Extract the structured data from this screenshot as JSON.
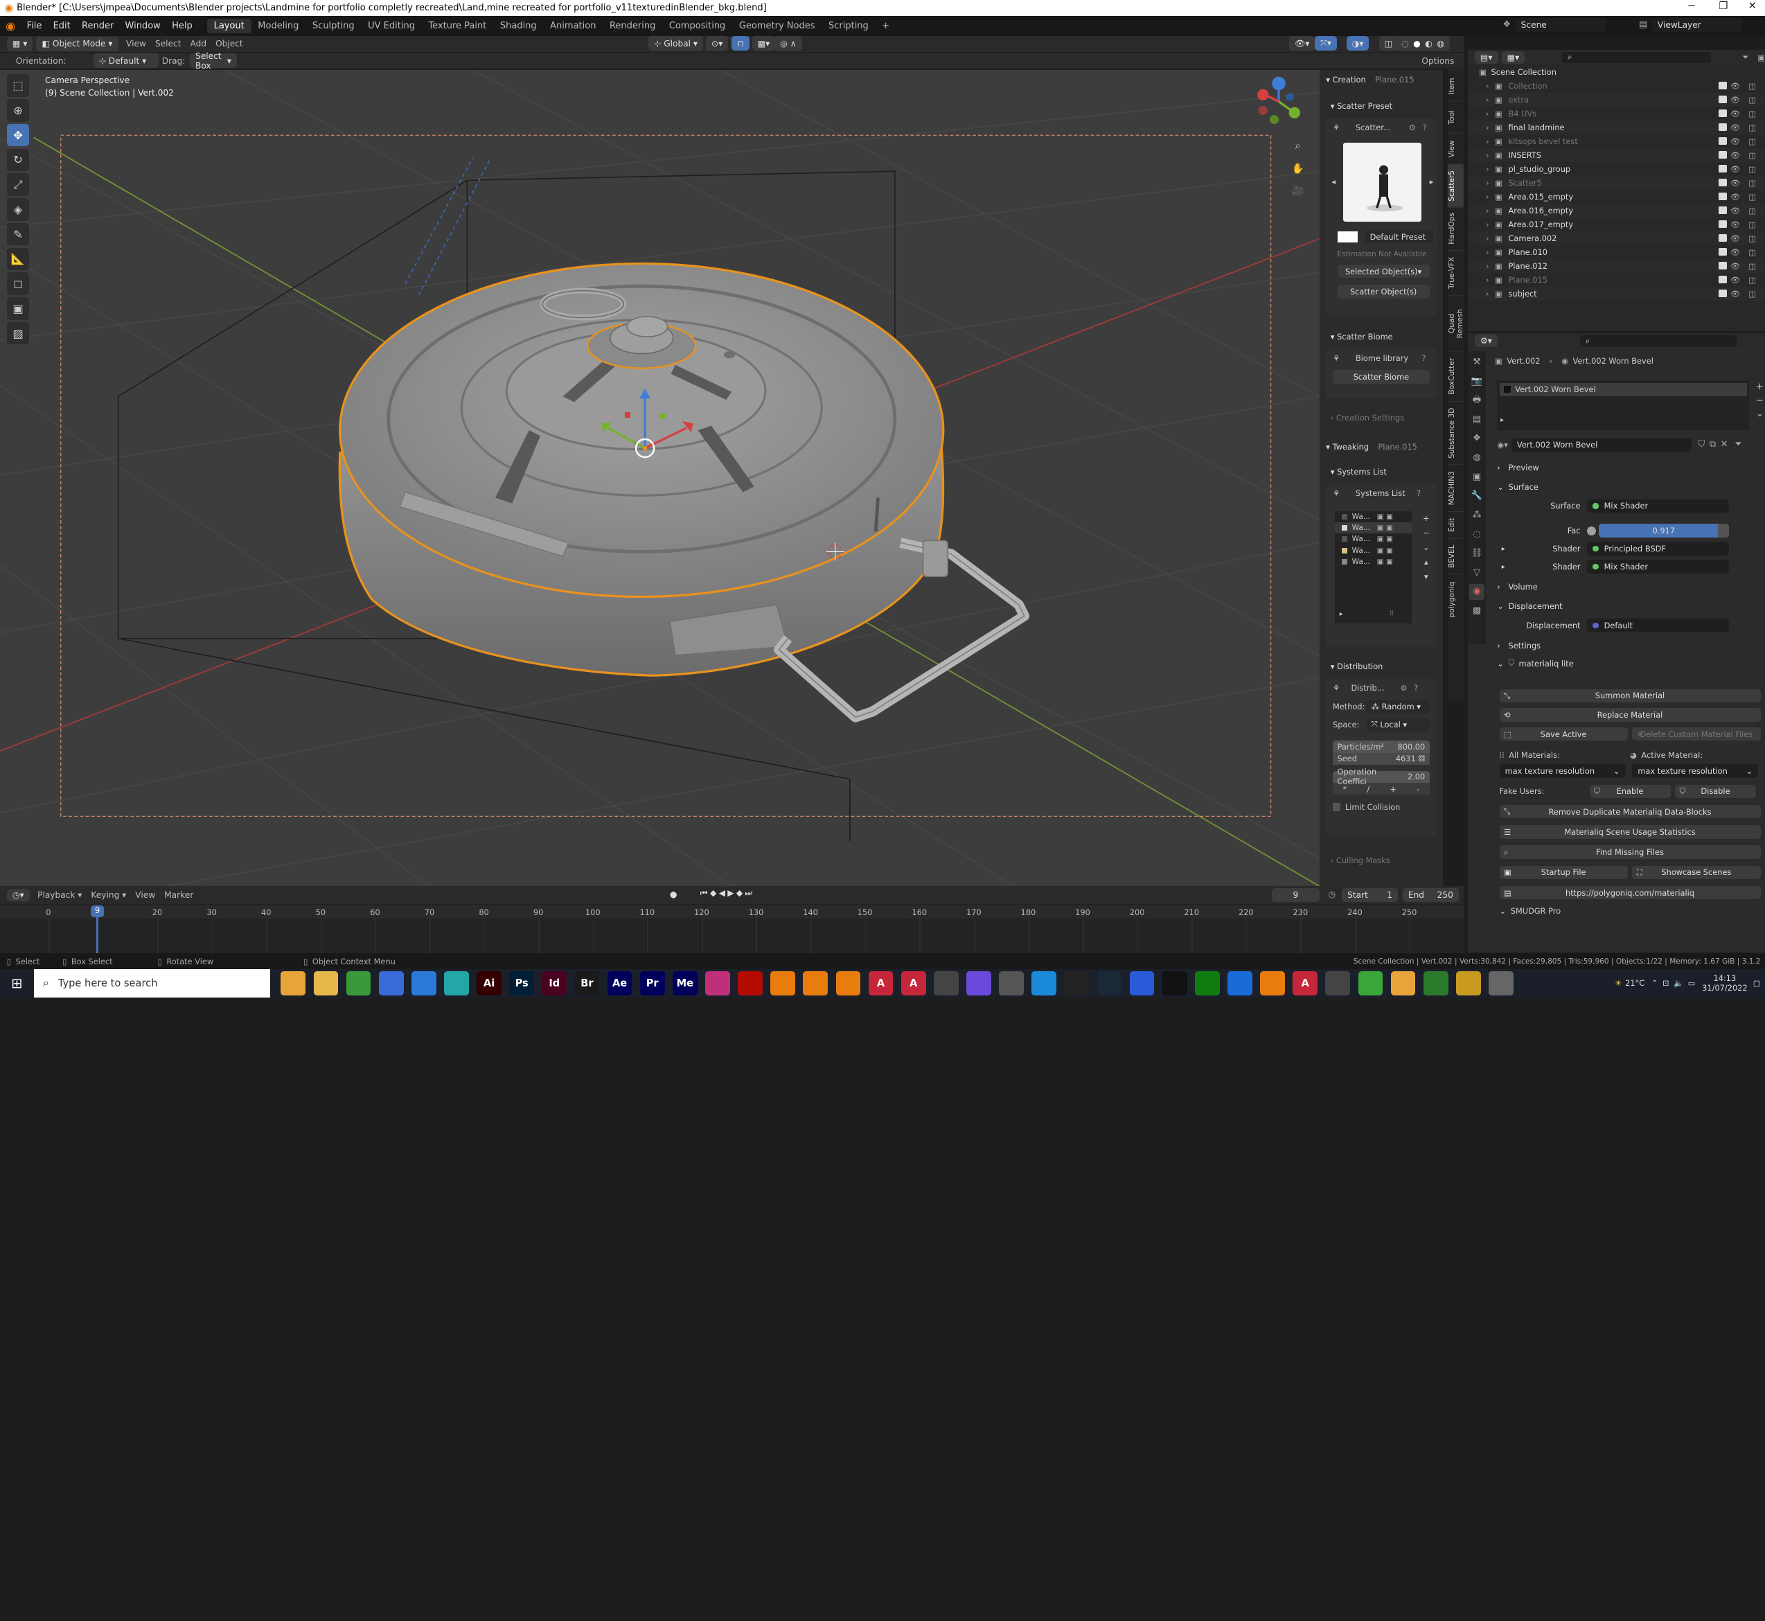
{
  "window": {
    "title": "Blender* [C:\\Users\\jmpea\\Documents\\Blender projects\\Landmine for portfolio completly recreated\\Land,mine recreated for portfolio_v11texturedinBlender_bkg.blend]"
  },
  "menu": {
    "items": [
      "File",
      "Edit",
      "Render",
      "Window",
      "Help"
    ],
    "workspaces": [
      "Layout",
      "Modeling",
      "Sculpting",
      "UV Editing",
      "Texture Paint",
      "Shading",
      "Animation",
      "Rendering",
      "Compositing",
      "Geometry Nodes",
      "Scripting"
    ],
    "active_workspace": "Layout",
    "scene_label": "Scene",
    "view_layer_label": "ViewLayer"
  },
  "viewport_header": {
    "mode": "Object Mode",
    "menus": [
      "View",
      "Select",
      "Add",
      "Object"
    ],
    "transform": "Global",
    "orientation_label": "Orientation:",
    "orientation_value": "Default",
    "drag_label": "Drag:",
    "drag_value": "Select Box",
    "options": "Options"
  },
  "viewport": {
    "camera_label": "Camera Perspective",
    "collection_label": "(9) Scene Collection | Vert.002"
  },
  "npanel": {
    "creation": "Creation",
    "creation_obj": "Plane.015",
    "scatter_preset": "Scatter Preset",
    "scatter_name": "Scatter...",
    "default_preset": "Default Preset",
    "estimation": "Estimation Not Available",
    "selected_objects": "Selected Object(s)",
    "scatter_objects": "Scatter Object(s)",
    "scatter_biome": "Scatter Biome",
    "biome_library": "Biome library",
    "scatter_biome_btn": "Scatter Biome",
    "creation_settings": "Creation Settings",
    "tweaking": "Tweaking",
    "tweaking_obj": "Plane.015",
    "systems_list": "Systems List",
    "systems_list_2": "Systems List",
    "systems": [
      "Wa...",
      "Wa...",
      "Wa...",
      "Wa...",
      "Wa..."
    ],
    "distribution": "Distribution",
    "distrib": "Distrib...",
    "method_label": "Method:",
    "method_value": "Random",
    "space_label": "Space:",
    "space_value": "Local",
    "particles_label": "Particles/m²",
    "particles_value": "800.00",
    "seed_label": "Seed",
    "seed_value": "4631",
    "op_coeff_label": "Operation Coeffici",
    "op_coeff_value": "2.00",
    "ops": [
      "*",
      "/",
      "+",
      "-"
    ],
    "limit_collision": "Limit Collision",
    "culling_masks": "Culling Masks"
  },
  "sidetabs": [
    "Item",
    "Tool",
    "View",
    "Scatter5",
    "HardOps",
    "True-VFX",
    "Quad Remesh",
    "BoxCutter",
    "Substance 3D",
    "MACHIN3",
    "Edit",
    "BEVEL",
    "polygoniq"
  ],
  "outliner": {
    "root": "Scene Collection",
    "items": [
      {
        "name": "Collection",
        "dim": true
      },
      {
        "name": "extra",
        "dim": true
      },
      {
        "name": "B4 UVs",
        "dim": true
      },
      {
        "name": "final landmine",
        "dim": false
      },
      {
        "name": "kitsops bevel test",
        "dim": true
      },
      {
        "name": "INSERTS",
        "dim": false
      },
      {
        "name": "pl_studio_group",
        "dim": false
      },
      {
        "name": "Scatter5",
        "dim": true
      },
      {
        "name": "Area.015_empty",
        "dim": false
      },
      {
        "name": "Area.016_empty",
        "dim": false
      },
      {
        "name": "Area.017_empty",
        "dim": false
      },
      {
        "name": "Camera.002",
        "dim": false
      },
      {
        "name": "Plane.010",
        "dim": false
      },
      {
        "name": "Plane.012",
        "dim": false
      },
      {
        "name": "Plane.015",
        "dim": true
      },
      {
        "name": "subject",
        "dim": false
      }
    ]
  },
  "properties": {
    "breadcrumb_obj": "Vert.002",
    "breadcrumb_mat": "Vert.002 Worn Bevel",
    "slot": "Vert.002 Worn Bevel",
    "material": "Vert.002 Worn Bevel",
    "preview": "Preview",
    "surface": "Surface",
    "surface_label": "Surface",
    "surface_value": "Mix Shader",
    "fac_label": "Fac",
    "fac_value": "0.917",
    "fac_fraction": 0.917,
    "shader1_label": "Shader",
    "shader1_value": "Principled BSDF",
    "shader2_label": "Shader",
    "shader2_value": "Mix Shader",
    "volume": "Volume",
    "displacement": "Displacement",
    "disp_label": "Displacement",
    "disp_value": "Default",
    "settings": "Settings",
    "materialiq": "materialiq lite",
    "summon": "Summon Material",
    "replace": "Replace Material",
    "save_active": "Save Active",
    "delete_custom": "Delete Custom Material Files",
    "all_materials": "All Materials:",
    "active_material": "Active Material:",
    "max_tex_1": "max texture resolution",
    "max_tex_2": "max texture resolution",
    "fake_users": "Fake Users:",
    "enable": "Enable",
    "disable": "Disable",
    "remove_dup": "Remove Duplicate Materialiq Data-Blocks",
    "usage_stats": "Materialiq Scene Usage Statistics",
    "find_missing": "Find Missing Files",
    "startup_file": "Startup File",
    "showcase": "Showcase Scenes",
    "url": "https://polygoniq.com/materialiq",
    "smudgr": "SMUDGR Pro"
  },
  "timeline": {
    "menus": [
      "Playback",
      "Keying",
      "View",
      "Marker"
    ],
    "current_frame": "9",
    "start_label": "Start",
    "start_value": "1",
    "end_label": "End",
    "end_value": "250",
    "ticks": [
      "0",
      "20",
      "30",
      "40",
      "50",
      "60",
      "70",
      "80",
      "90",
      "100",
      "110",
      "120",
      "130",
      "140",
      "150",
      "160",
      "170",
      "180",
      "190",
      "200",
      "210",
      "220",
      "230",
      "240",
      "250"
    ],
    "ticks_pos": [
      0,
      20,
      30,
      40,
      50,
      60,
      70,
      80,
      90,
      100,
      110,
      120,
      130,
      140,
      150,
      160,
      170,
      180,
      190,
      200,
      210,
      220,
      230,
      240,
      250
    ],
    "playhead": 9
  },
  "statusbar": {
    "select": "Select",
    "box_select": "Box Select",
    "rotate_view": "Rotate View",
    "context_menu": "Object Context Menu",
    "stats": "Scene Collection | Vert.002 | Verts:30,842 | Faces:29,805 | Tris:59,960 | Objects:1/22 | Memory: 1.67 GiB | 3.1.2"
  },
  "taskbar": {
    "search_placeholder": "Type here to search",
    "temperature": "21°C",
    "time": "14:13",
    "date": "31/07/2022",
    "apps": [
      {
        "icon": "chrome-icon",
        "label": "",
        "color": "#e8a33a"
      },
      {
        "icon": "folder-icon",
        "label": "",
        "color": "#e6b84a"
      },
      {
        "icon": "app-green-icon",
        "label": "",
        "color": "#3a9a3a"
      },
      {
        "icon": "store-icon",
        "label": "",
        "color": "#3a6ad8"
      },
      {
        "icon": "mail-icon",
        "label": "",
        "color": "#2a7ad8"
      },
      {
        "icon": "app-teal-icon",
        "label": "",
        "color": "#22a6a6"
      },
      {
        "icon": "illustrator-icon",
        "label": "Ai",
        "color": "#330000"
      },
      {
        "icon": "photoshop-icon",
        "label": "Ps",
        "color": "#001e36"
      },
      {
        "icon": "indesign-icon",
        "label": "Id",
        "color": "#49021f"
      },
      {
        "icon": "bridge-icon",
        "label": "Br",
        "color": "#1a1a1a"
      },
      {
        "icon": "aftereffects-icon",
        "label": "Ae",
        "color": "#00005b"
      },
      {
        "icon": "premiere-icon",
        "label": "Pr",
        "color": "#00005b"
      },
      {
        "icon": "mediaencoder-icon",
        "label": "Me",
        "color": "#00005b"
      },
      {
        "icon": "app-pink-icon",
        "label": "",
        "color": "#c0307a"
      },
      {
        "icon": "acrobat-icon",
        "label": "",
        "color": "#b30b00"
      },
      {
        "icon": "blender-icon",
        "label": "",
        "color": "#e87d0d"
      },
      {
        "icon": "blender-icon",
        "label": "",
        "color": "#e87d0d"
      },
      {
        "icon": "blender-icon",
        "label": "",
        "color": "#e87d0d"
      },
      {
        "icon": "affinity-icon",
        "label": "A",
        "color": "#c6263a"
      },
      {
        "icon": "affinity-icon",
        "label": "A",
        "color": "#c6263a"
      },
      {
        "icon": "camera-app-icon",
        "label": "",
        "color": "#444"
      },
      {
        "icon": "app-purple-icon",
        "label": "",
        "color": "#6a4ad8"
      },
      {
        "icon": "calculator-icon",
        "label": "",
        "color": "#555"
      },
      {
        "icon": "app-blue-icon",
        "label": "",
        "color": "#1a8ad8"
      },
      {
        "icon": "terminal-icon",
        "label": "",
        "color": "#222"
      },
      {
        "icon": "steam-icon",
        "label": "",
        "color": "#1b2838"
      },
      {
        "icon": "app-blue2-icon",
        "label": "",
        "color": "#2a5ad8"
      },
      {
        "icon": "unreal-icon",
        "label": "",
        "color": "#111"
      },
      {
        "icon": "xbox-icon",
        "label": "",
        "color": "#107c10"
      },
      {
        "icon": "app-blue3-icon",
        "label": "",
        "color": "#1a6ad8"
      },
      {
        "icon": "vlc-icon",
        "label": "",
        "color": "#e87d0d"
      },
      {
        "icon": "affinity-icon",
        "label": "A",
        "color": "#c6263a"
      },
      {
        "icon": "app-gray-icon",
        "label": "",
        "color": "#444"
      },
      {
        "icon": "app-green2-icon",
        "label": "",
        "color": "#3aa63a"
      },
      {
        "icon": "app-orange-icon",
        "label": "",
        "color": "#e8a33a"
      },
      {
        "icon": "app-darkgreen-icon",
        "label": "",
        "color": "#2a7a2a"
      },
      {
        "icon": "app-yellow-icon",
        "label": "",
        "color": "#c89a20"
      },
      {
        "icon": "app-white-icon",
        "label": "",
        "color": "#666"
      }
    ]
  },
  "colors": {
    "accent": "#4772b3",
    "selection_orange": "#e8921d",
    "axis_x": "#c2413f",
    "axis_y": "#8db839",
    "axis_z": "#3d7fd8",
    "grid": "#484848",
    "viewport_bg": "#3d3d3d"
  }
}
